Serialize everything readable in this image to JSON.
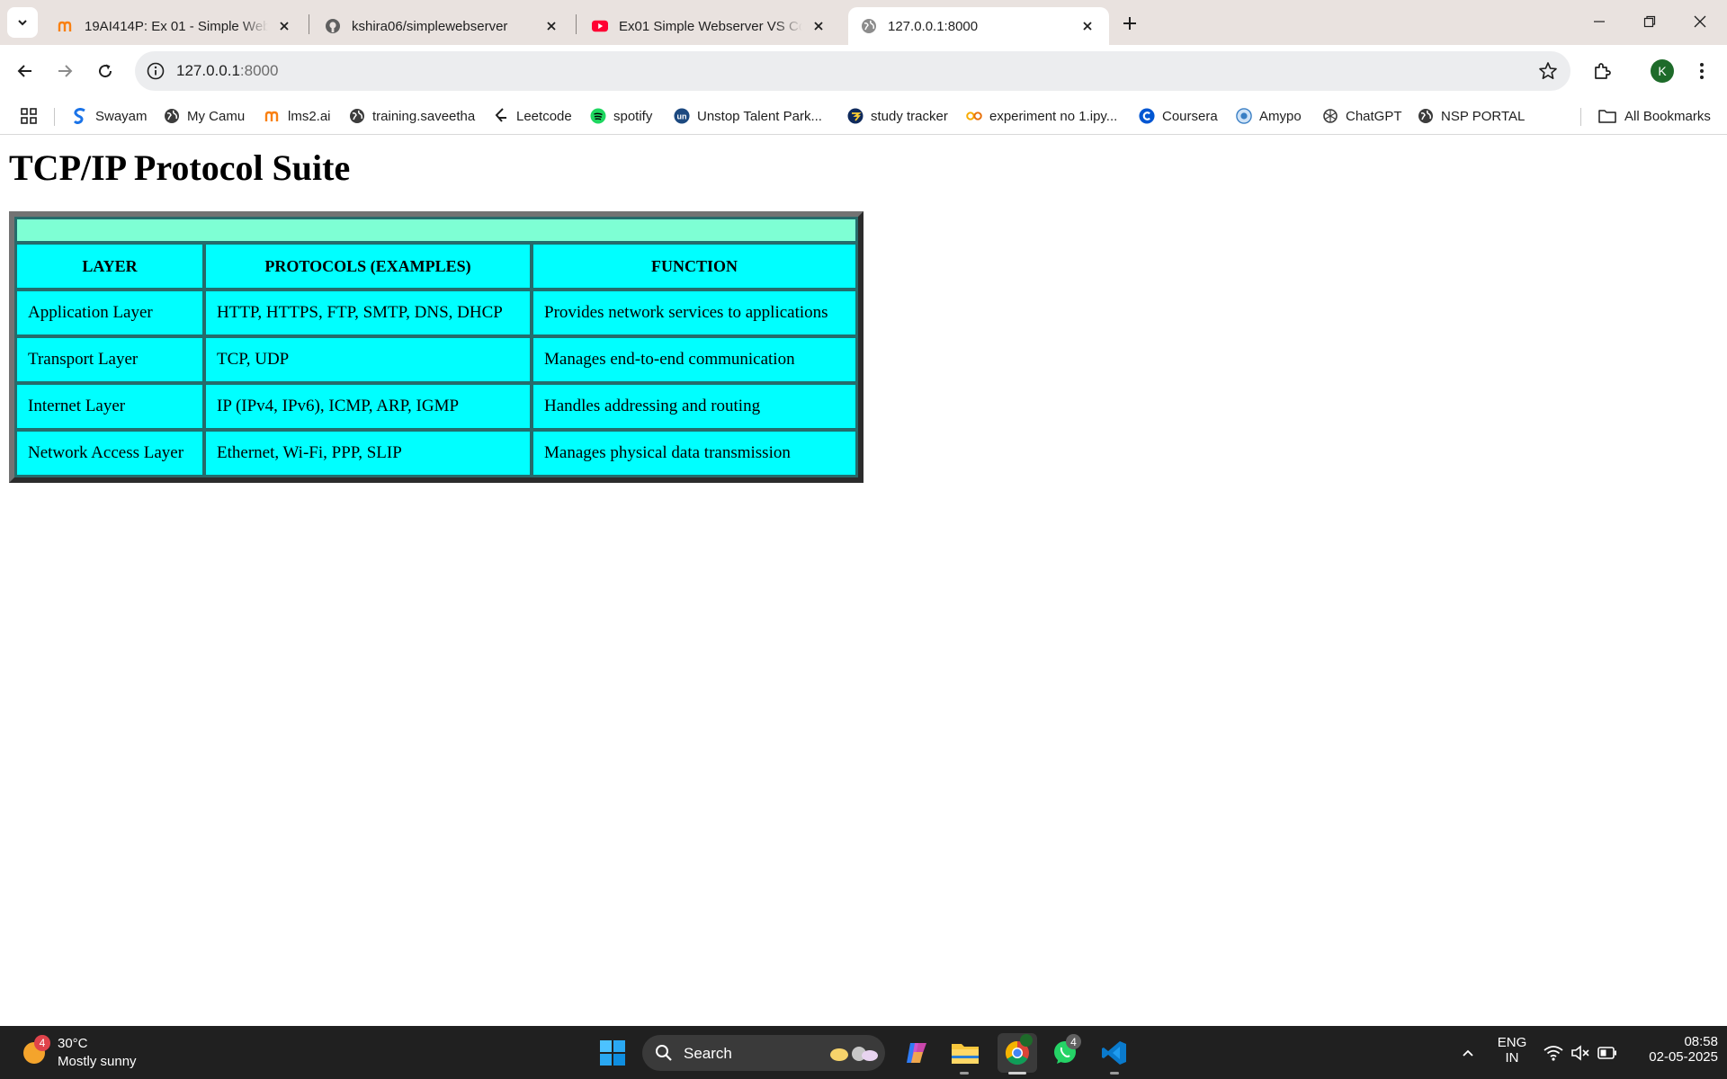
{
  "browser": {
    "tabs": [
      {
        "title": "19AI414P: Ex 01 - Simple Webserver",
        "active": false
      },
      {
        "title": "kshira06/simplewebserver",
        "active": false
      },
      {
        "title": "Ex01 Simple Webserver VS Code",
        "active": false
      },
      {
        "title": "127.0.0.1:8000",
        "active": true
      }
    ],
    "address": {
      "host": "127.0.0.1",
      "port": ":8000"
    },
    "profile_initial": "K",
    "bookmarks": [
      "Swayam",
      "My Camu",
      "lms2.ai",
      "training.saveetha",
      "Leetcode",
      "spotify",
      "Unstop Talent Park...",
      "study tracker",
      "experiment no 1.ipy...",
      "Coursera",
      "Amypo",
      "ChatGPT",
      "NSP PORTAL"
    ],
    "all_bookmarks": "All Bookmarks"
  },
  "page": {
    "heading": "TCP/IP Protocol Suite",
    "table": {
      "headers": [
        "LAYER",
        "PROTOCOLS (EXAMPLES)",
        "FUNCTION"
      ],
      "rows": [
        [
          "Application Layer",
          "HTTP, HTTPS, FTP, SMTP, DNS, DHCP",
          "Provides network services to applications"
        ],
        [
          "Transport Layer",
          "TCP, UDP",
          "Manages end-to-end communication"
        ],
        [
          "Internet Layer",
          "IP (IPv4, IPv6), ICMP, ARP, IGMP",
          "Handles addressing and routing"
        ],
        [
          "Network Access Layer",
          "Ethernet, Wi-Fi, PPP, SLIP",
          "Manages physical data transmission"
        ]
      ],
      "colors": {
        "cell": "#00ffff",
        "caption_row": "#7effd4"
      }
    }
  },
  "taskbar": {
    "weather": {
      "badge": "4",
      "temp": "30°C",
      "condition": "Mostly sunny"
    },
    "search_label": "Search",
    "whatsapp_badge": "4",
    "language": [
      "ENG",
      "IN"
    ],
    "time": "08:58",
    "date": "02-05-2025"
  }
}
